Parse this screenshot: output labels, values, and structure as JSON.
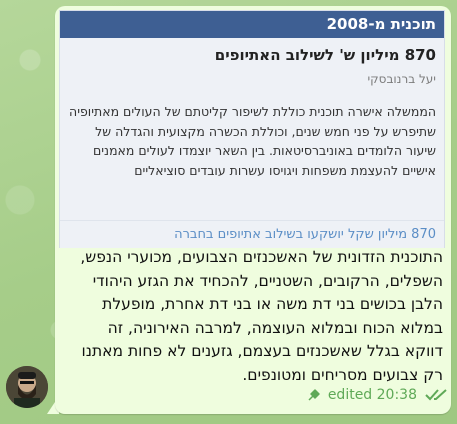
{
  "card": {
    "header": "תוכנית מ-2008",
    "title": "870 מיליון ש' לשילוב האתיופים",
    "author": "יעל ברנובסקי",
    "body": "הממשלה אישרה תוכנית כוללת לשיפור קליטתם של העולים מאתיופיה שתיפרש על פני חמש שנים, וכוללת הכשרה מקצועית והגדלה של שיעור הלומדים באוניברסיטאות. בין השאר יוצמדו לעולים מאמנים אישיים להעצמת משפחות ויגויסו עשרות עובדים סוציאליים",
    "footer_link": "870 מיליון שקל יושקעו בשילוב אתיופים בחברה"
  },
  "message": {
    "text": "התוכנית הזדונית של האשכנזים הצבועים, מכוערי הנפש, השפלים, הרקובים, השטניים, להכחיד את הגזע היהודי הלבן בכושים בני דת משה או בני דת אחרת, מופעלת במלוא הכוח ובמלוא העוצמה, למרבה האירוניה, זה דווקא בגלל שאשכנזים בעצמם, גזענים לא פחות מאתנו רק צבועים מסריחים ומטונפים.",
    "status": "edited 20:38",
    "colors": {
      "bubble": "#effdde",
      "meta": "#5fa957",
      "header": "#3e5f93",
      "link": "#5b8ec6"
    }
  },
  "icons": {
    "pin": "pin-icon",
    "read": "double-check-icon",
    "avatar": "avatar"
  }
}
